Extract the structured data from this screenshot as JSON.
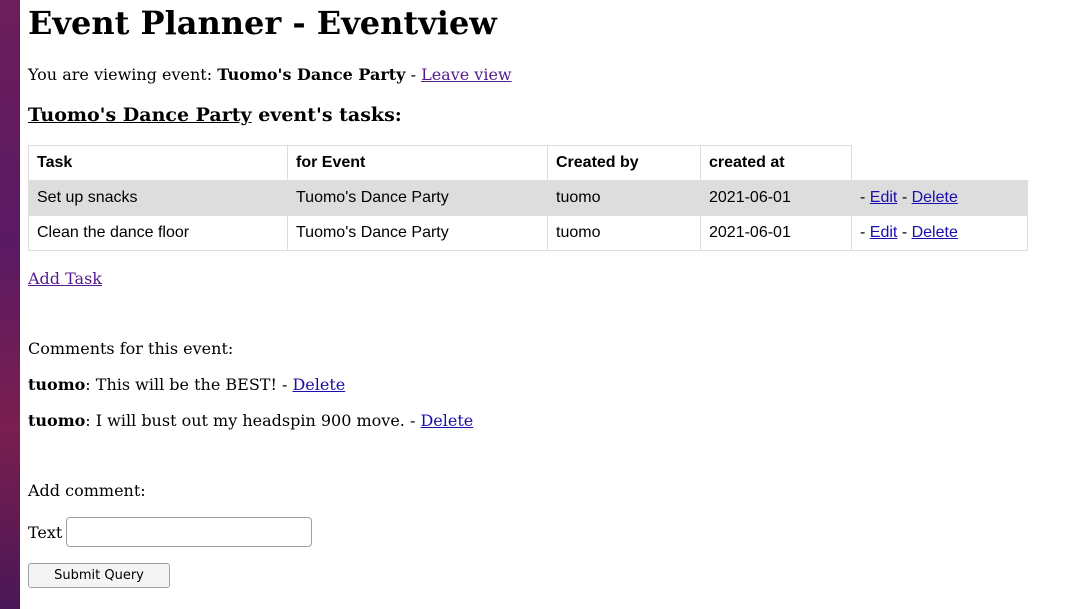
{
  "page": {
    "title": "Event Planner - Eventview"
  },
  "viewing": {
    "prefix": "You are viewing event: ",
    "event_name": "Tuomo's Dance Party",
    "separator": " - ",
    "leave_link": "Leave view"
  },
  "tasks_heading": {
    "event_link": "Tuomo's Dance Party",
    "suffix": " event's tasks:"
  },
  "tasks_table": {
    "headers": [
      "Task",
      "for Event",
      "Created by",
      "created at"
    ],
    "rows": [
      {
        "task": "Set up snacks",
        "event": "Tuomo's Dance Party",
        "created_by": "tuomo",
        "created_at": "2021-06-01",
        "edit": "Edit",
        "delete": "Delete"
      },
      {
        "task": "Clean the dance floor",
        "event": "Tuomo's Dance Party",
        "created_by": "tuomo",
        "created_at": "2021-06-01",
        "edit": "Edit",
        "delete": "Delete"
      }
    ],
    "action_sep": "-"
  },
  "add_task_link": "Add Task",
  "comments": {
    "title": "Comments for this event:",
    "items": [
      {
        "author": "tuomo",
        "text": ": This will be the BEST! - ",
        "delete": "Delete"
      },
      {
        "author": "tuomo",
        "text": ": I will bust out my headspin 900 move. - ",
        "delete": "Delete"
      }
    ]
  },
  "add_comment": {
    "title": "Add comment:",
    "text_label": "Text",
    "text_value": "",
    "submit_label": "Submit Query"
  }
}
